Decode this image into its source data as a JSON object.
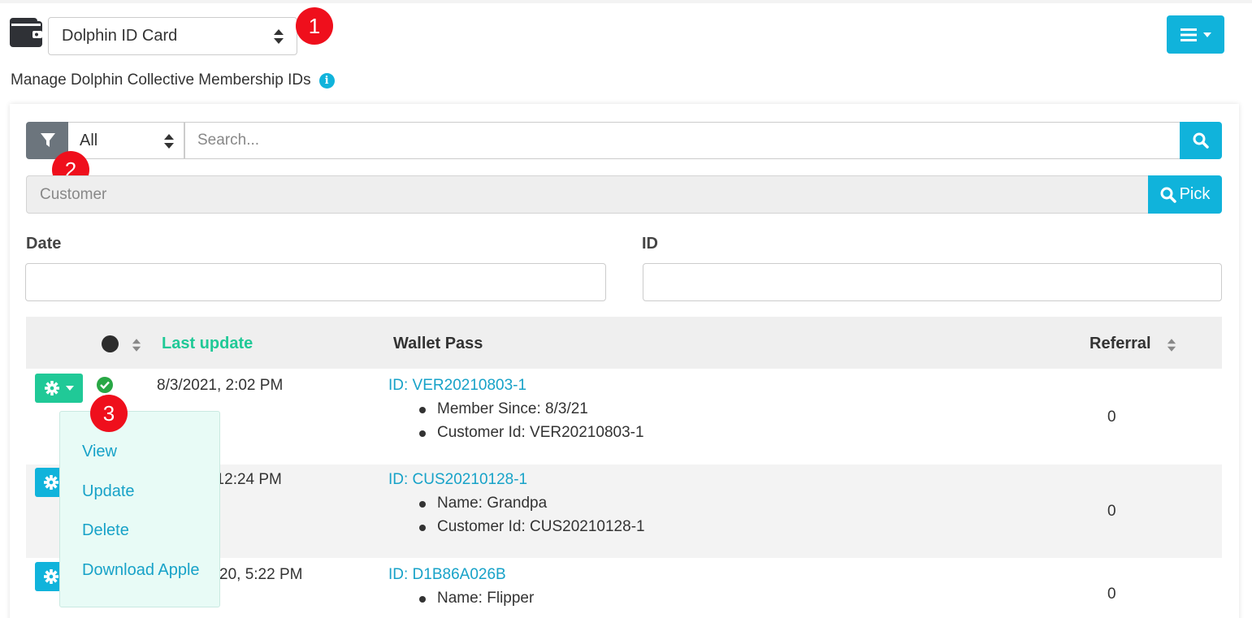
{
  "header": {
    "card_type": "Dolphin ID Card",
    "subtitle": "Manage Dolphin Collective Membership IDs",
    "info_icon": "info-icon",
    "menu_icon": "bars-icon"
  },
  "badges": [
    "1",
    "2",
    "3"
  ],
  "filter": {
    "scope": "All",
    "search_placeholder": "Search...",
    "customer_placeholder": "Customer",
    "pick_label": "Pick"
  },
  "fields": {
    "date_label": "Date",
    "id_label": "ID"
  },
  "table": {
    "col_last_update": "Last update",
    "col_wallet_pass": "Wallet Pass",
    "col_referral": "Referral",
    "rows": [
      {
        "last_update": "8/3/2021, 2:02 PM",
        "pass_id": "ID: VER20210803-1",
        "details": [
          "Member Since: 8/3/21",
          "Customer Id: VER20210803-1"
        ],
        "referral": "0"
      },
      {
        "last_update": ", 12:24 PM",
        "pass_id": "ID: CUS20210128-1",
        "details": [
          "Name: Grandpa",
          "Customer Id: CUS20210128-1"
        ],
        "referral": "0"
      },
      {
        "last_update": "20, 5:22 PM",
        "pass_id": "ID: D1B86A026B",
        "details": [
          "Name: Flipper"
        ],
        "referral": "0"
      }
    ]
  },
  "row_menu": {
    "items": [
      "View",
      "Update",
      "Delete",
      "Download Apple"
    ]
  },
  "colors": {
    "accent_blue": "#10b3db",
    "accent_green": "#20c997",
    "badge_red": "#ef0f1c"
  }
}
